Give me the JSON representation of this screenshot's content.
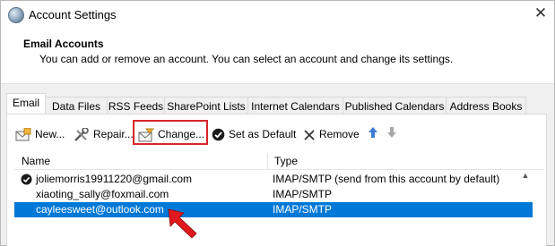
{
  "window": {
    "title": "Account Settings",
    "close_glyph": "✕"
  },
  "header": {
    "title": "Email Accounts",
    "description": "You can add or remove an account. You can select an account and change its settings."
  },
  "tabs": [
    {
      "label": "Email"
    },
    {
      "label": "Data Files"
    },
    {
      "label": "RSS Feeds"
    },
    {
      "label": "SharePoint Lists"
    },
    {
      "label": "Internet Calendars"
    },
    {
      "label": "Published Calendars"
    },
    {
      "label": "Address Books"
    }
  ],
  "toolbar": {
    "new_label": "New...",
    "repair_label": "Repair...",
    "change_label": "Change...",
    "default_label": "Set as Default",
    "remove_label": "Remove"
  },
  "list": {
    "col_name": "Name",
    "col_type": "Type",
    "rows": [
      {
        "name": "joliemorris19911220@gmail.com",
        "type": "IMAP/SMTP (send from this account by default)"
      },
      {
        "name": "xiaoting_sally@foxmail.com",
        "type": "IMAP/SMTP"
      },
      {
        "name": "cayleesweet@outlook.com",
        "type": "IMAP/SMTP"
      }
    ]
  },
  "colors": {
    "highlight_box": "#d6262b",
    "selection": "#0078d7",
    "annotation_arrow": "#e0191f"
  }
}
